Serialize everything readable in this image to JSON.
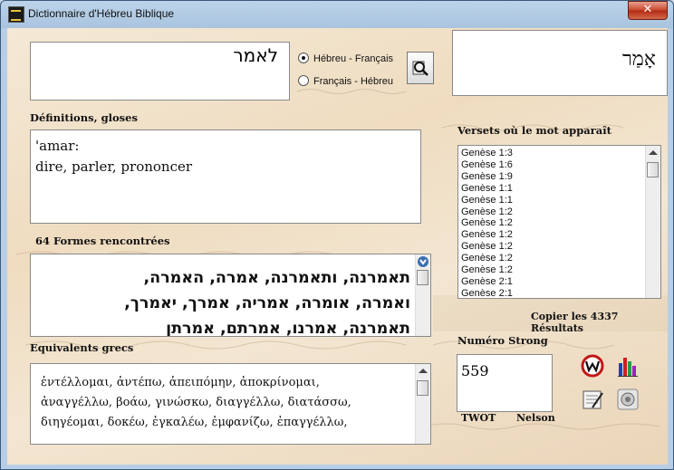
{
  "window": {
    "title": "Dictionnaire d'Hébreu Biblique",
    "close_label": "✕"
  },
  "search": {
    "value": "לאמר",
    "selected_mode": "Hébreu - Français"
  },
  "modes": [
    "Hébreu - Français",
    "Français - Hébreu"
  ],
  "display_word": "אָמַר",
  "definitions": {
    "label": "Définitions, gloses",
    "lines": [
      "'amar:",
      "dire, parler, prononcer"
    ]
  },
  "forms": {
    "label": "64 Formes rencontrées",
    "lines": [
      "תאמרנה, ותאמרנה, אמרה, האמרה,",
      "ואמרה, אומרה, אמריה, אמרך, יאמרך,",
      "תאמרנה, אמרנו, אמרתם, אמרתן"
    ]
  },
  "greek": {
    "label": "Equivalents grecs",
    "lines": [
      "ἐντέλλομαι, ἀντέπω, ἀπειπόμην, ἀποκρίνομαι,",
      "ἀναγγέλλω, βοάω, γινώσκω, διαγγέλλω, διατάσσω,",
      "διηγέομαι, δοκέω, ἐγκαλέω, ἐμφανίζω, ἐπαγγέλλω,"
    ]
  },
  "verses": {
    "label": "Versets où le mot apparaît",
    "items": [
      "Genèse 1:3",
      "Genèse 1:6",
      "Genèse 1:9",
      "Genèse 1:1",
      "Genèse 1:1",
      "Genèse 1:2",
      "Genèse 1:2",
      "Genèse 1:2",
      "Genèse 1:2",
      "Genèse 1:2",
      "Genèse 1:2",
      "Genèse 2:1",
      "Genèse 2:1"
    ],
    "copy_label": "Copier les 4337 Résultats"
  },
  "strong": {
    "label": "Numéro Strong",
    "value": "559",
    "twot_label": "TWOT",
    "nelson_label": "Nelson"
  }
}
